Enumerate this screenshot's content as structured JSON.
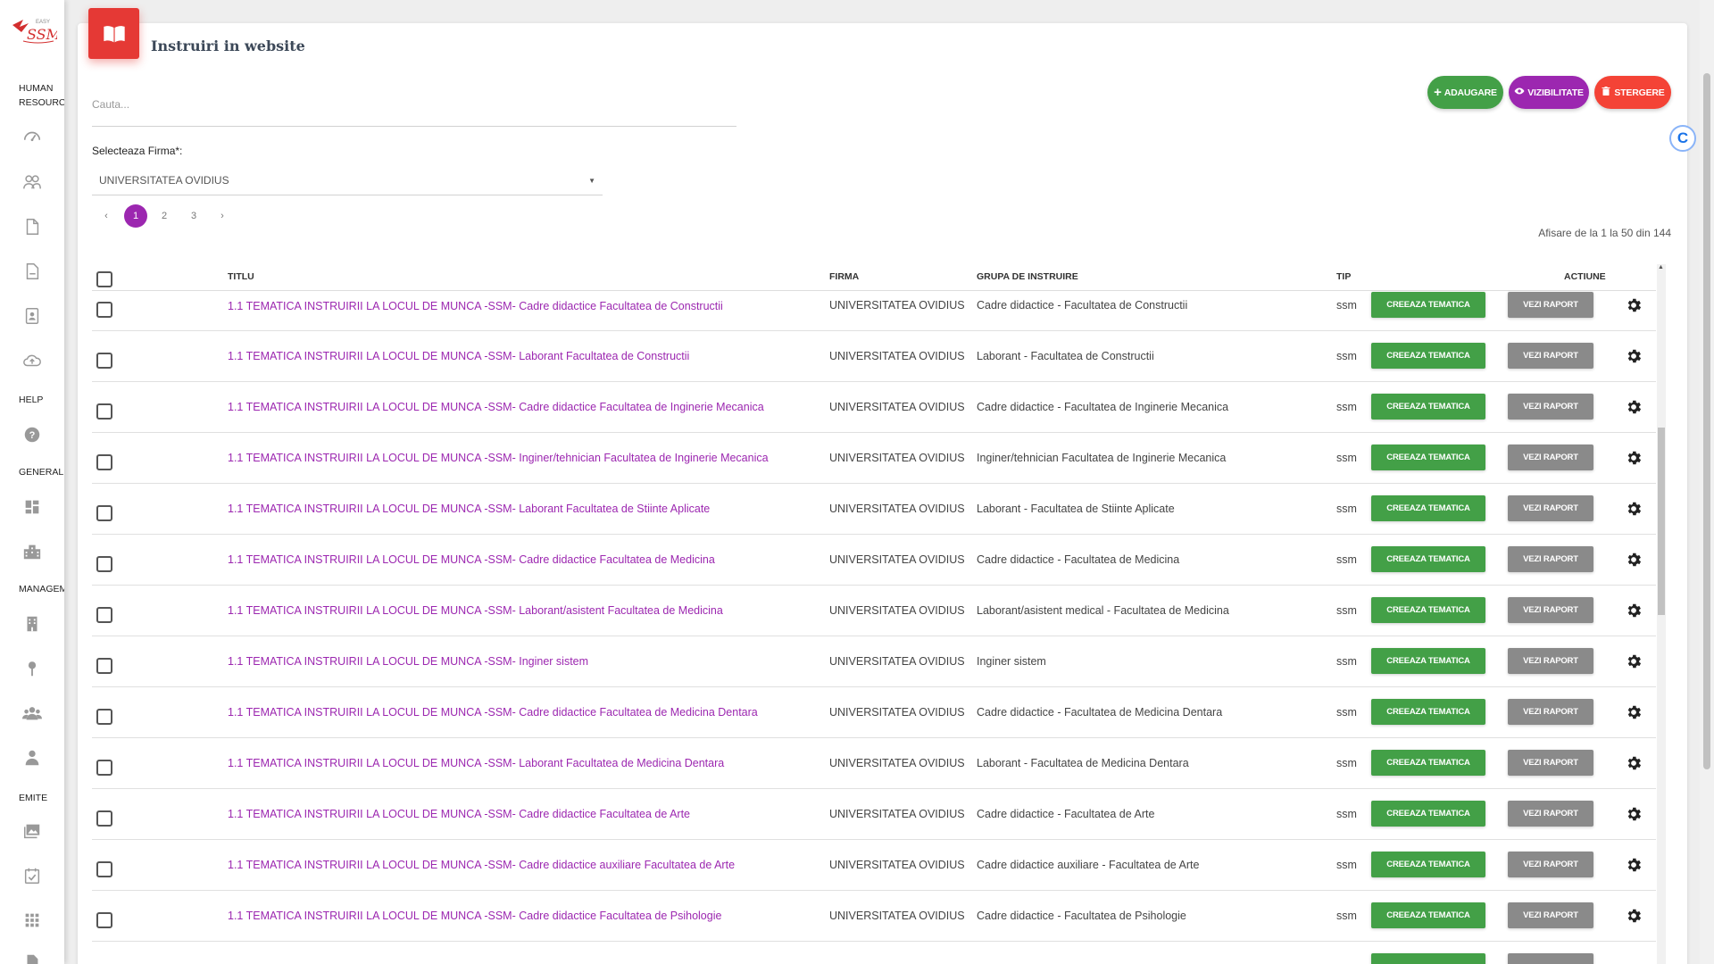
{
  "sidebar": {
    "sections": [
      "HUMAN RESOURCE",
      "HELP",
      "GENERALE",
      "MANAGEM",
      "EMITE"
    ],
    "icons": [
      "dashboard-icon",
      "users-icon",
      "document-icon",
      "document-edit-icon",
      "badge-icon",
      "cloud-upload-icon",
      "help-icon",
      "grid-icon",
      "building-icon",
      "office-icon",
      "location-pin-icon",
      "group-icon",
      "user-icon",
      "photos-icon",
      "calendar-check-icon",
      "apps-icon",
      "file-icon"
    ]
  },
  "header": {
    "title": "Instruiri in website"
  },
  "search": {
    "placeholder": "Cauta..."
  },
  "actions": {
    "add": "ADAUGARE",
    "visibility": "VIZIBILITATE",
    "delete": "STERGERE"
  },
  "firm": {
    "label": "Selecteaza Firma*:",
    "value": "UNIVERSITATEA OVIDIUS"
  },
  "pagination": {
    "prev": "‹",
    "pages": [
      "1",
      "2",
      "3"
    ],
    "next": "›",
    "current": "1"
  },
  "info": "Afisare de la 1 la 50 din 144",
  "columns": {
    "title": "TITLU",
    "firm": "FIRMA",
    "group": "GRUPA DE INSTRUIRE",
    "type": "TIP",
    "actions": "ACTIUNE"
  },
  "buttons": {
    "create": "CREEAZA TEMATICA",
    "report": "VEZI RAPORT"
  },
  "rows": [
    {
      "title": "1.1 TEMATICA INSTRUIRII LA LOCUL DE MUNCA -SSM- Cadre didactice Facultatea de Constructii",
      "firm": "UNIVERSITATEA OVIDIUS",
      "group": "Cadre didactice - Facultatea de Constructii",
      "type": "ssm"
    },
    {
      "title": "1.1 TEMATICA INSTRUIRII LA LOCUL DE MUNCA -SSM- Laborant Facultatea de Constructii",
      "firm": "UNIVERSITATEA OVIDIUS",
      "group": "Laborant - Facultatea de Constructii",
      "type": "ssm"
    },
    {
      "title": "1.1 TEMATICA INSTRUIRII LA LOCUL DE MUNCA -SSM- Cadre didactice Facultatea de Inginerie Mecanica",
      "firm": "UNIVERSITATEA OVIDIUS",
      "group": "Cadre didactice - Facultatea de Inginerie Mecanica",
      "type": "ssm"
    },
    {
      "title": "1.1 TEMATICA INSTRUIRII LA LOCUL DE MUNCA -SSM- Inginer/tehnician Facultatea de Inginerie Mecanica",
      "firm": "UNIVERSITATEA OVIDIUS",
      "group": "Inginer/tehnician Facultatea de Inginerie Mecanica",
      "type": "ssm"
    },
    {
      "title": "1.1 TEMATICA INSTRUIRII LA LOCUL DE MUNCA -SSM- Laborant Facultatea de Stiinte Aplicate",
      "firm": "UNIVERSITATEA OVIDIUS",
      "group": "Laborant - Facultatea de Stiinte Aplicate",
      "type": "ssm"
    },
    {
      "title": "1.1 TEMATICA INSTRUIRII LA LOCUL DE MUNCA -SSM- Cadre didactice Facultatea de Medicina",
      "firm": "UNIVERSITATEA OVIDIUS",
      "group": "Cadre didactice - Facultatea de Medicina",
      "type": "ssm"
    },
    {
      "title": "1.1 TEMATICA INSTRUIRII LA LOCUL DE MUNCA -SSM- Laborant/asistent Facultatea de Medicina",
      "firm": "UNIVERSITATEA OVIDIUS",
      "group": "Laborant/asistent medical - Facultatea de Medicina",
      "type": "ssm"
    },
    {
      "title": "1.1 TEMATICA INSTRUIRII LA LOCUL DE MUNCA -SSM- Inginer sistem",
      "firm": "UNIVERSITATEA OVIDIUS",
      "group": "Inginer sistem",
      "type": "ssm"
    },
    {
      "title": "1.1 TEMATICA INSTRUIRII LA LOCUL DE MUNCA -SSM- Cadre didactice Facultatea de Medicina Dentara",
      "firm": "UNIVERSITATEA OVIDIUS",
      "group": "Cadre didactice - Facultatea de Medicina Dentara",
      "type": "ssm"
    },
    {
      "title": "1.1 TEMATICA INSTRUIRII LA LOCUL DE MUNCA -SSM- Laborant Facultatea de Medicina Dentara",
      "firm": "UNIVERSITATEA OVIDIUS",
      "group": "Laborant - Facultatea de Medicina Dentara",
      "type": "ssm"
    },
    {
      "title": "1.1 TEMATICA INSTRUIRII LA LOCUL DE MUNCA -SSM- Cadre didactice Facultatea de Arte",
      "firm": "UNIVERSITATEA OVIDIUS",
      "group": "Cadre didactice - Facultatea de Arte",
      "type": "ssm"
    },
    {
      "title": "1.1 TEMATICA INSTRUIRII LA LOCUL DE MUNCA -SSM- Cadre didactice auxiliare Facultatea de Arte",
      "firm": "UNIVERSITATEA OVIDIUS",
      "group": "Cadre didactice auxiliare - Facultatea de Arte",
      "type": "ssm"
    },
    {
      "title": "1.1 TEMATICA INSTRUIRII LA LOCUL DE MUNCA -SSM- Cadre didactice Facultatea de Psihologie",
      "firm": "UNIVERSITATEA OVIDIUS",
      "group": "Cadre didactice - Facultatea de Psihologie",
      "type": "ssm"
    }
  ],
  "colors": {
    "primary": "#9c27b0",
    "success": "#43a047",
    "danger": "#f44336",
    "header_icon": "#e53935",
    "report": "#8a8a8a"
  }
}
